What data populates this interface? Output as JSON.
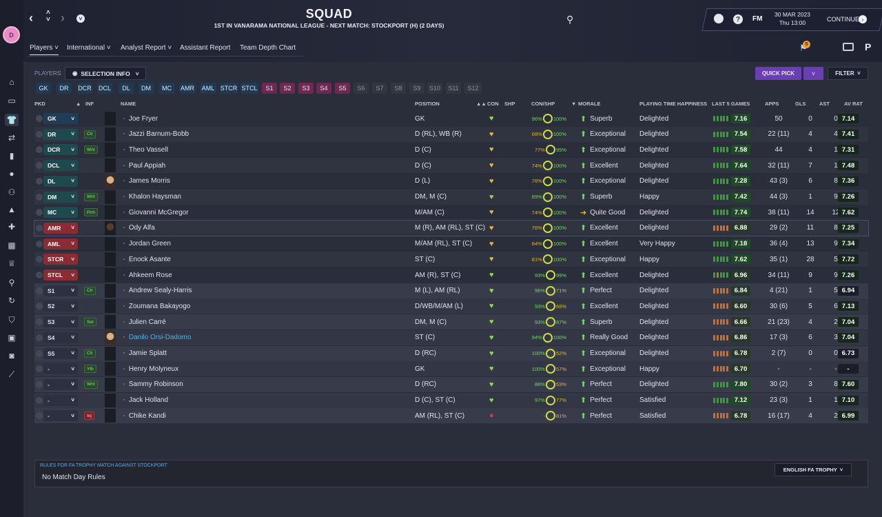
{
  "header": {
    "title": "SQUAD",
    "subtitle": "1ST IN VANARAMA NATIONAL LEAGUE - NEXT MATCH: STOCKPORT (H) (2 DAYS)",
    "fm_label": "FM",
    "date": "30 MAR 2023",
    "day_time": "Thu 13:00",
    "continue_label": "CONTINUE",
    "notification_count": "5"
  },
  "club_badge_text": "D",
  "tabs": [
    "Players",
    "International",
    "Analyst Report",
    "Assistant Report",
    "Team Depth Chart"
  ],
  "toolbar": {
    "players_label": "PLAYERS",
    "selection_info_label": "SELECTION INFO",
    "quick_pick_label": "QUICK PICK",
    "filter_label": "FILTER"
  },
  "position_filters": [
    "GK",
    "DR",
    "DCR",
    "DCL",
    "DL",
    "DM",
    "MC",
    "AMR",
    "AML",
    "STCR",
    "STCL"
  ],
  "sub_filters": [
    "S1",
    "S2",
    "S3",
    "S4",
    "S5",
    "S6",
    "S7",
    "S8",
    "S9",
    "S10",
    "S11",
    "S12"
  ],
  "columns": {
    "pkd": "PKD",
    "inf": "INF",
    "name": "NAME",
    "position": "POSITION",
    "con": "CON",
    "shp": "SHP",
    "con_shp": "CON/SHP",
    "morale": "MORALE",
    "pth": "PLAYING TIME HAPPINESS",
    "last5": "LAST 5 GAMES",
    "apps": "APPS",
    "gls": "GLS",
    "ast": "AST",
    "av_rat": "AV RAT"
  },
  "players": [
    {
      "pick": "GK",
      "inf": "",
      "name": "Joe Fryer",
      "position": "GK",
      "con": "96%",
      "shp": "100%",
      "morale": "Superb",
      "pth": "Delighted",
      "last5": "7.16",
      "apps": "50",
      "gls": "0",
      "ast": "0",
      "av_rat": "7.14"
    },
    {
      "pick": "DR",
      "inf": "Ctr",
      "name": "Jazzi Barnum-Bobb",
      "position": "D (RL), WB (R)",
      "con": "68%",
      "shp": "100%",
      "morale": "Exceptional",
      "pth": "Delighted",
      "last5": "7.54",
      "apps": "22 (11)",
      "gls": "4",
      "ast": "4",
      "av_rat": "7.41"
    },
    {
      "pick": "DCR",
      "inf": "Wnt",
      "name": "Theo Vassell",
      "position": "D (C)",
      "con": "77%",
      "shp": "95%",
      "morale": "Exceptional",
      "pth": "Delighted",
      "last5": "7.58",
      "apps": "44",
      "gls": "4",
      "ast": "1",
      "av_rat": "7.31"
    },
    {
      "pick": "DCL",
      "inf": "",
      "name": "Paul Appiah",
      "position": "D (C)",
      "con": "74%",
      "shp": "100%",
      "morale": "Excellent",
      "pth": "Delighted",
      "last5": "7.64",
      "apps": "32 (11)",
      "gls": "7",
      "ast": "1",
      "av_rat": "7.48"
    },
    {
      "pick": "DL",
      "inf": "",
      "name": "James Morris",
      "position": "D (L)",
      "con": "76%",
      "shp": "100%",
      "morale": "Exceptional",
      "pth": "Delighted",
      "last5": "7.28",
      "apps": "43 (3)",
      "gls": "6",
      "ast": "8",
      "av_rat": "7.36"
    },
    {
      "pick": "DM",
      "inf": "Wnt",
      "name": "Khalon Haysman",
      "position": "DM, M (C)",
      "con": "89%",
      "shp": "100%",
      "morale": "Superb",
      "pth": "Happy",
      "last5": "7.42",
      "apps": "44 (3)",
      "gls": "1",
      "ast": "9",
      "av_rat": "7.26"
    },
    {
      "pick": "MC",
      "inf": "Prm",
      "name": "Giovanni McGregor",
      "position": "M/AM (C)",
      "con": "74%",
      "shp": "100%",
      "morale": "Quite Good",
      "pth": "Delighted",
      "last5": "7.74",
      "apps": "38 (11)",
      "gls": "14",
      "ast": "12",
      "av_rat": "7.62"
    },
    {
      "pick": "AMR",
      "inf": "",
      "name": "Ody Alfa",
      "position": "M (R), AM (RL), ST (C)",
      "con": "76%",
      "shp": "100%",
      "morale": "Excellent",
      "pth": "Delighted",
      "last5": "6.88",
      "apps": "29 (2)",
      "gls": "11",
      "ast": "8",
      "av_rat": "7.25"
    },
    {
      "pick": "AML",
      "inf": "",
      "name": "Jordan Green",
      "position": "M/AM (RL), ST (C)",
      "con": "84%",
      "shp": "100%",
      "morale": "Excellent",
      "pth": "Very Happy",
      "last5": "7.18",
      "apps": "36 (4)",
      "gls": "13",
      "ast": "9",
      "av_rat": "7.34"
    },
    {
      "pick": "STCR",
      "inf": "",
      "name": "Enock Asante",
      "position": "ST (C)",
      "con": "81%",
      "shp": "100%",
      "morale": "Exceptional",
      "pth": "Happy",
      "last5": "7.62",
      "apps": "35 (1)",
      "gls": "28",
      "ast": "5",
      "av_rat": "7.72"
    },
    {
      "pick": "STCL",
      "inf": "",
      "name": "Ahkeem Rose",
      "position": "AM (R), ST (C)",
      "con": "93%",
      "shp": "99%",
      "morale": "Excellent",
      "pth": "Delighted",
      "last5": "6.96",
      "apps": "34 (11)",
      "gls": "9",
      "ast": "9",
      "av_rat": "7.26"
    },
    {
      "pick": "S1",
      "inf": "Ctr",
      "name": "Andrew Sealy-Harris",
      "position": "M (L), AM (RL)",
      "con": "96%",
      "shp": "71%",
      "morale": "Perfect",
      "pth": "Delighted",
      "last5": "6.84",
      "apps": "4 (21)",
      "gls": "1",
      "ast": "5",
      "av_rat": "6.94"
    },
    {
      "pick": "S2",
      "inf": "",
      "name": "Zoumana Bakayogo",
      "position": "D/WB/M/AM (L)",
      "con": "93%",
      "shp": "68%",
      "morale": "Excellent",
      "pth": "Delighted",
      "last5": "6.60",
      "apps": "30 (6)",
      "gls": "5",
      "ast": "6",
      "av_rat": "7.13"
    },
    {
      "pick": "S3",
      "inf": "Set",
      "name": "Julien Carré",
      "position": "DM, M (C)",
      "con": "93%",
      "shp": "87%",
      "morale": "Superb",
      "pth": "Delighted",
      "last5": "6.66",
      "apps": "21 (23)",
      "gls": "4",
      "ast": "2",
      "av_rat": "7.04"
    },
    {
      "pick": "S4",
      "inf": "",
      "name": "Danilo Orsi-Dadomo",
      "position": "ST (C)",
      "con": "94%",
      "shp": "100%",
      "morale": "Really Good",
      "pth": "Delighted",
      "last5": "6.86",
      "apps": "17 (3)",
      "gls": "6",
      "ast": "3",
      "av_rat": "7.04"
    },
    {
      "pick": "S5",
      "inf": "Ctr",
      "name": "Jamie Splatt",
      "position": "D (RC)",
      "con": "100%",
      "shp": "52%",
      "morale": "Exceptional",
      "pth": "Delighted",
      "last5": "6.78",
      "apps": "2 (7)",
      "gls": "0",
      "ast": "0",
      "av_rat": "6.73"
    },
    {
      "pick": "-",
      "inf": "Yth",
      "name": "Henry Molyneux",
      "position": "GK",
      "con": "100%",
      "shp": "57%",
      "morale": "Exceptional",
      "pth": "Happy",
      "last5": "6.70",
      "apps": "-",
      "gls": "-",
      "ast": "-",
      "av_rat": "-"
    },
    {
      "pick": "-",
      "inf": "Wnt",
      "name": "Sammy Robinson",
      "position": "D (RC)",
      "con": "88%",
      "shp": "53%",
      "morale": "Perfect",
      "pth": "Delighted",
      "last5": "7.80",
      "apps": "30 (2)",
      "gls": "3",
      "ast": "8",
      "av_rat": "7.60"
    },
    {
      "pick": "-",
      "inf": "",
      "name": "Jack Holland",
      "position": "D (C), ST (C)",
      "con": "97%",
      "shp": "77%",
      "morale": "Perfect",
      "pth": "Satisfied",
      "last5": "7.12",
      "apps": "23 (3)",
      "gls": "1",
      "ast": "1",
      "av_rat": "7.10"
    },
    {
      "pick": "-",
      "inf": "Inj",
      "name": "Chike Kandi",
      "position": "AM (RL), ST (C)",
      "con": "-",
      "shp": "81%",
      "morale": "Perfect",
      "pth": "Satisfied",
      "last5": "6.78",
      "apps": "16 (17)",
      "gls": "4",
      "ast": "2",
      "av_rat": "6.99"
    }
  ],
  "footer": {
    "rules_title": "RULES FOR FA TROPHY MATCH AGAINST STOCKPORT",
    "rules_value": "No Match Day Rules",
    "competition": "ENGLISH FA TROPHY"
  },
  "colors": {
    "accent": "#e88ec7",
    "quick_pick": "#6a3fb4",
    "link": "#4fb3e8"
  },
  "icons": [
    "back-icon",
    "forward-icon",
    "dropdown-icon",
    "search-icon",
    "help-icon",
    "home-icon",
    "inbox-icon",
    "squad-icon",
    "transfers-icon",
    "tactics-icon",
    "trophy-icon",
    "settings-icon"
  ]
}
